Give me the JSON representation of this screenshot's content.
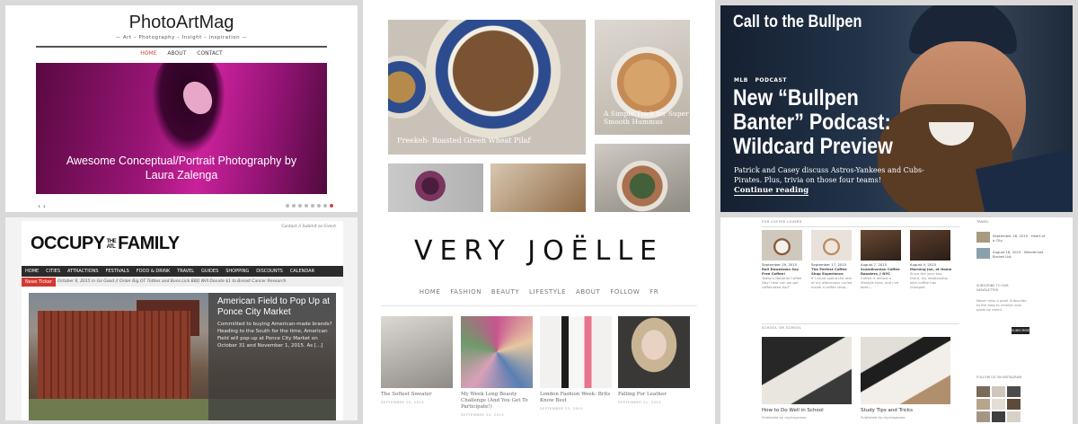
{
  "photoartmag": {
    "title": "PhotoArtMag",
    "tagline": "— Art – Photography – Insight – inspiration —",
    "nav": [
      "HOME",
      "ABOUT",
      "CONTACT"
    ],
    "caption_line1": "Awesome Conceptual/Portrait Photography by",
    "caption_line2": "Laura Zalenga",
    "arrows": "‹ ›",
    "accent_color": "#d2463c"
  },
  "food": {
    "caption_main": "Freekeh- Roasted Green Wheat Pilaf",
    "caption_side_line1": "A Simple Trick for Super",
    "caption_side_line2": "Smooth Hummus"
  },
  "bullpen": {
    "header": "Call to the Bullpen",
    "tags": [
      "MLB",
      "PODCAST"
    ],
    "title": "New “Bullpen Banter” Podcast: Wildcard Preview",
    "description": "Patrick and Casey discuss Astros-Yankees and Cubs-Pirates. Plus, trivia on those four teams!",
    "link": "Continue reading"
  },
  "occupy": {
    "utility": "Contact // Submit an Event",
    "logo_left": "OCCUPY",
    "logo_mid_top": "THE",
    "logo_mid_bottom": "ATL",
    "logo_right": "FAMILY",
    "nav": [
      "HOME",
      "CITIES",
      "ATTRACTIONS",
      "FESTIVALS",
      "FOOD & DRINK",
      "TRAVEL",
      "GUIDES",
      "SHOPPING",
      "DISCOUNTS",
      "CALENDAR"
    ],
    "ticker_label": "News Ticker",
    "ticker_text": "October 6, 2015 in Go Good // Order Big OT Totties and Buns Lick BBQ Will Donate $1 to Breast Cancer Research",
    "headline": "American Field to Pop Up at Ponce City Market",
    "excerpt": "Committed to buying American-made brands? Heading to the South for the time, American Field will pop-up at Ponce City Market on October 31 and November 1, 2015. As [...]",
    "accent_color": "#d23a32"
  },
  "veryjoelle": {
    "logo": "VERY JOËLLE",
    "nav": [
      "HOME",
      "FASHION",
      "BEAUTY",
      "LIFESTYLE",
      "ABOUT",
      "FOLLOW",
      "FR"
    ],
    "posts": [
      {
        "title": "The Softest Sweater",
        "date": "SEPTEMBER 25, 2015"
      },
      {
        "title": "My Week Long Beauty Challenge (And You Get To Participate!)",
        "date": "SEPTEMBER 24, 2015"
      },
      {
        "title": "London Fashion Week: Brits Know Best",
        "date": "SEPTEMBER 23, 2015"
      },
      {
        "title": "Falling For Leather",
        "date": "SEPTEMBER 21, 2015"
      }
    ]
  },
  "coffee": {
    "section_top": "FOR COFFEE LOVERS",
    "section_bottom": "SCHOOL OR SCHOOL",
    "posts": [
      {
        "date": "September 29, 2015",
        "title": "Roll Downtown Say Free Coffee!",
        "text": "Today's National Coffee Day! How can we get caffeinated too?"
      },
      {
        "date": "September 17, 2015",
        "title": "The Perfect Coffee Shop Experience",
        "text": "If I could spend the rest of my afternoons curled inside a coffee shop..."
      },
      {
        "date": "August 7, 2015",
        "title": "Scandinavian Coffee Roasters // NYC",
        "text": "Coffee is almost a lifestyle here, and I've been..."
      },
      {
        "date": "August 4, 2015",
        "title": "Morning Joe, at Home",
        "text": "Since the year two there, my relationship with coffee has changed."
      }
    ],
    "big_posts": [
      {
        "title": "How to Do Well in School",
        "meta": "Published by mylongsnow"
      },
      {
        "title": "Study Tips and Tricks",
        "meta": "Published by mylongsnow"
      }
    ],
    "sidebar_travel": "TRAVEL",
    "sidebar_items": [
      "September 28, 2015 · Heart of a City",
      "August 18, 2015 · Wanderlust Bucket List"
    ],
    "subscribe_heading": "SUBSCRIBE TO OUR NEWSLETTER",
    "subscribe_text": "Never miss a post! Subscribe to the blog to receive new posts by email.",
    "subscribe_button": "SUBSCRIBE",
    "instagram_heading": "FOLLOW US ON INSTAGRAM"
  }
}
